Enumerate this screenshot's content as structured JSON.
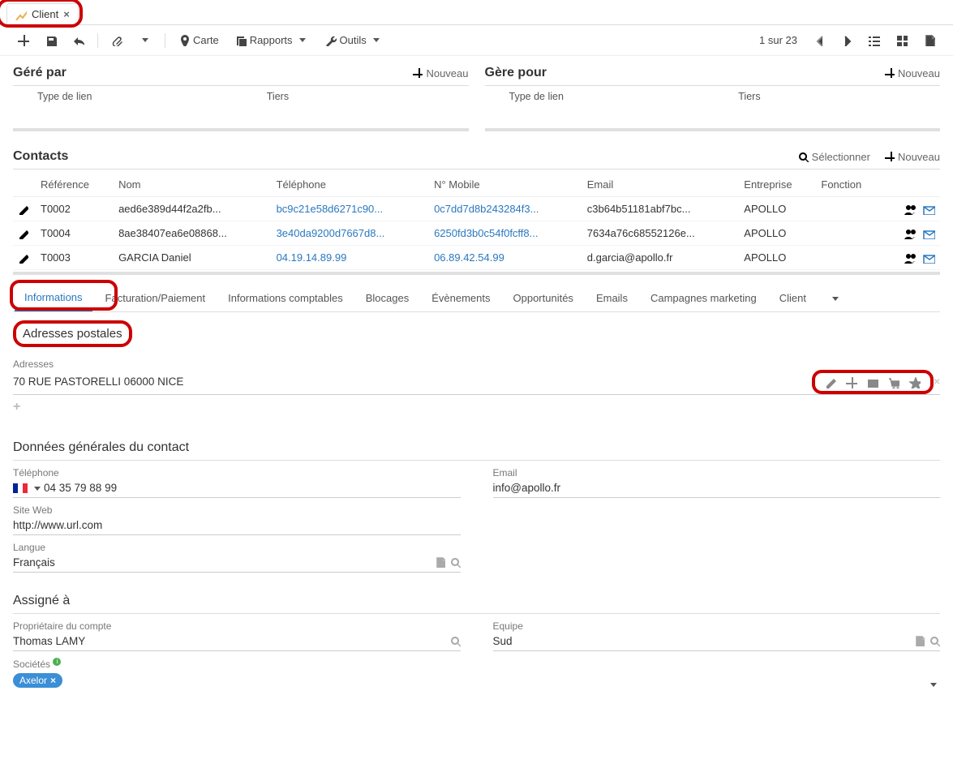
{
  "tab": {
    "label": "Client"
  },
  "toolbar": {
    "carte": "Carte",
    "rapports": "Rapports",
    "outils": "Outils",
    "pager": "1 sur 23"
  },
  "panels": {
    "gere_par": {
      "title": "Géré par",
      "nouveau": "Nouveau",
      "col1": "Type de lien",
      "col2": "Tiers"
    },
    "gere_pour": {
      "title": "Gère pour",
      "nouveau": "Nouveau",
      "col1": "Type de lien",
      "col2": "Tiers"
    }
  },
  "contacts": {
    "title": "Contacts",
    "select": "Sélectionner",
    "nouveau": "Nouveau",
    "headers": {
      "ref": "Référence",
      "nom": "Nom",
      "tel": "Téléphone",
      "mob": "N° Mobile",
      "email": "Email",
      "ent": "Entreprise",
      "fct": "Fonction"
    },
    "rows": [
      {
        "ref": "T0002",
        "nom": "aed6e389d44f2a2fb...",
        "tel": "bc9c21e58d6271c90...",
        "mob": "0c7dd7d8b243284f3...",
        "email": "c3b64b51181abf7bc...",
        "ent": "APOLLO"
      },
      {
        "ref": "T0004",
        "nom": "8ae38407ea6e08868...",
        "tel": "3e40da9200d7667d8...",
        "mob": "6250fd3b0c54f0fcff8...",
        "email": "7634a76c68552126e...",
        "ent": "APOLLO"
      },
      {
        "ref": "T0003",
        "nom": "GARCIA Daniel",
        "tel": "04.19.14.89.99",
        "mob": "06.89.42.54.99",
        "email": "d.garcia@apollo.fr",
        "ent": "APOLLO"
      }
    ]
  },
  "tabs2": [
    "Informations",
    "Facturation/Paiement",
    "Informations comptables",
    "Blocages",
    "Évènements",
    "Opportunités",
    "Emails",
    "Campagnes marketing",
    "Client"
  ],
  "addr": {
    "title": "Adresses postales",
    "label": "Adresses",
    "value": "70 RUE PASTORELLI 06000 NICE"
  },
  "general": {
    "title": "Données générales du contact",
    "tel_label": "Téléphone",
    "tel_value": "04 35 79 88 99",
    "email_label": "Email",
    "email_value": "info@apollo.fr",
    "site_label": "Site Web",
    "site_value": "http://www.url.com",
    "lang_label": "Langue",
    "lang_value": "Français"
  },
  "assigne": {
    "title": "Assigné à",
    "owner_label": "Propriétaire du compte",
    "owner_value": "Thomas LAMY",
    "team_label": "Equipe",
    "team_value": "Sud",
    "soc_label": "Sociétés",
    "soc_chip": "Axelor"
  }
}
